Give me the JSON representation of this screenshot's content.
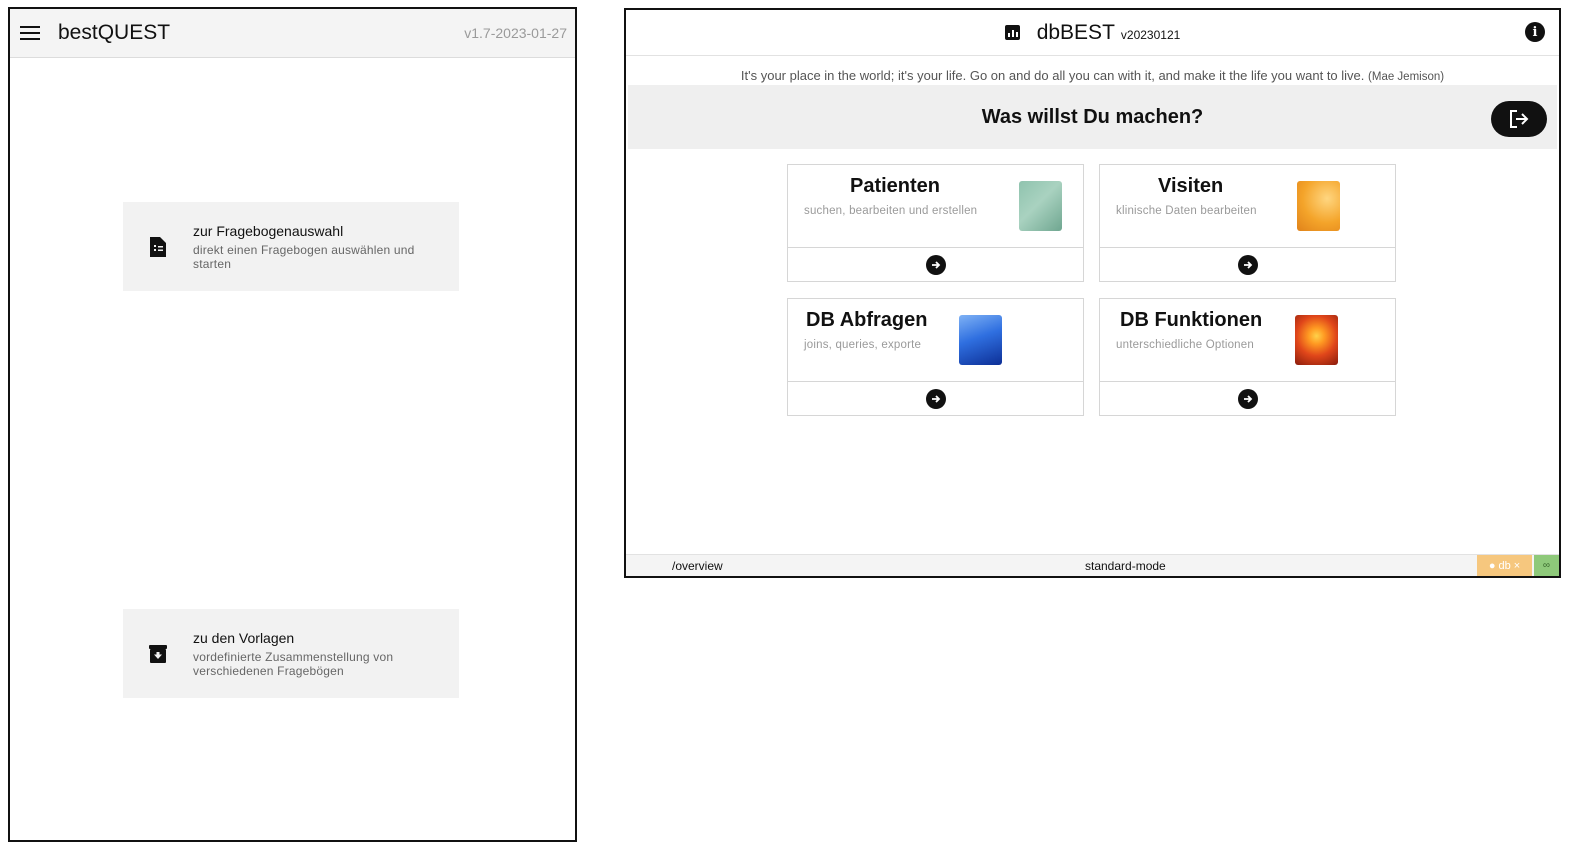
{
  "bestquest": {
    "title": "bestQUEST",
    "version": "v1.7-2023-01-27",
    "cards": [
      {
        "title": "zur Fragebogenauswahl",
        "subtitle": "direkt einen Fragebogen auswählen und starten",
        "icon": "document-icon"
      },
      {
        "title": "zu den Vorlagen",
        "subtitle": "vordefinierte Zusammenstellung von verschiedenen Fragebögen",
        "icon": "archive-icon"
      }
    ]
  },
  "dbbest": {
    "title": "dbBEST",
    "version": "v20230121",
    "quote": "It's your place in the world; it's your life. Go on and do all you can with it, and make it the life you want to live.",
    "quote_author": "(Mae Jemison)",
    "heading": "Was willst Du machen?",
    "tiles": [
      {
        "title": "Patienten",
        "subtitle": "suchen, bearbeiten und erstellen",
        "image": "green-marble-thumbnail"
      },
      {
        "title": "Visiten",
        "subtitle": "klinische Daten bearbeiten",
        "image": "orange-slice-thumbnail"
      },
      {
        "title": "DB Abfragen",
        "subtitle": "joins, queries, exporte",
        "image": "blue-wave-thumbnail"
      },
      {
        "title": "DB Funktionen",
        "subtitle": "unterschiedliche Optionen",
        "image": "sunset-thumbnail"
      }
    ],
    "status": {
      "route": "/overview",
      "mode": "standard-mode",
      "db_label": "db",
      "db_close": "×"
    }
  },
  "colors": {
    "panel_header": "#f4f4f4",
    "card_bg": "#f2f2f2",
    "banner_bg": "#efefef",
    "db_chip": "#f6c77e",
    "link_chip": "#8ec97a"
  }
}
